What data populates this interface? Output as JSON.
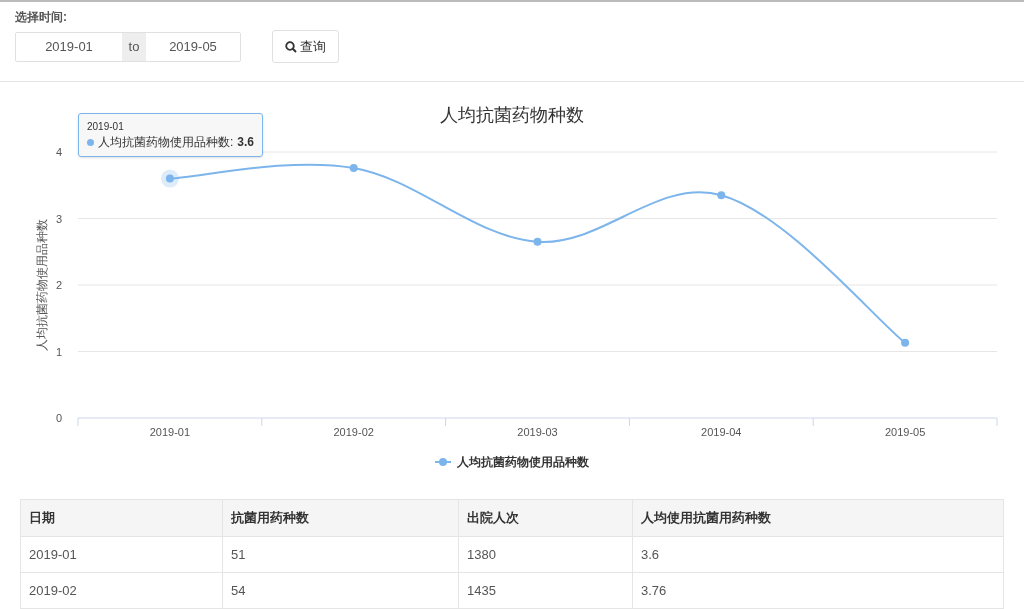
{
  "filter": {
    "label": "选择时间:",
    "start": "2019-01",
    "separator": "to",
    "end": "2019-05",
    "query_button": "查询"
  },
  "chart": {
    "tooltip": {
      "title": "2019-01",
      "series_name": "人均抗菌药物使用品种数:",
      "value": "3.6"
    },
    "hover_points": [
      {
        "selected": true
      },
      {
        "selected": false
      },
      {
        "selected": false
      },
      {
        "selected": false
      },
      {
        "selected": false
      }
    ],
    "chart_data": {
      "type": "line",
      "title": "人均抗菌药物种数",
      "ylabel": "人均抗菌药物使用品种数",
      "categories": [
        "2019-01",
        "2019-02",
        "2019-03",
        "2019-04",
        "2019-05"
      ],
      "grid": true,
      "series": [
        {
          "name": "人均抗菌药物使用品种数",
          "color": "#7cb5ec",
          "marker": true,
          "values": [
            3.6,
            3.76,
            2.65,
            3.35,
            1.13
          ]
        }
      ],
      "ylim": [
        0,
        4
      ],
      "yticks": [
        0,
        1,
        2,
        3,
        4
      ]
    }
  },
  "table": {
    "columns": [
      "日期",
      "抗菌用药种数",
      "出院人次",
      "人均使用抗菌用药种数"
    ],
    "rows": [
      [
        "2019-01",
        "51",
        "1380",
        "3.6"
      ],
      [
        "2019-02",
        "54",
        "1435",
        "3.76"
      ]
    ]
  }
}
